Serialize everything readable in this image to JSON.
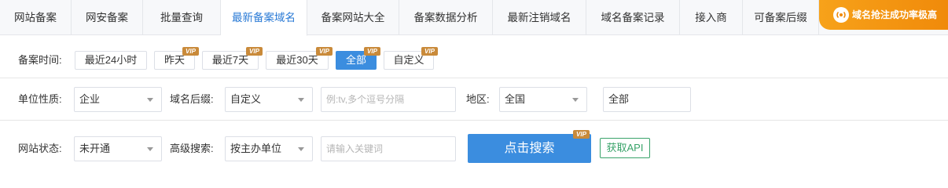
{
  "tabs": [
    {
      "label": "网站备案"
    },
    {
      "label": "网安备案"
    },
    {
      "label": "批量查询"
    },
    {
      "label": "最新备案域名"
    },
    {
      "label": "备案网站大全"
    },
    {
      "label": "备案数据分析"
    },
    {
      "label": "最新注销域名"
    },
    {
      "label": "域名备案记录"
    },
    {
      "label": "接入商"
    },
    {
      "label": "可备案后缀"
    }
  ],
  "active_tab": "最新备案域名",
  "promo": {
    "label": "域名抢注成功率极高"
  },
  "time_filter": {
    "label": "备案时间:",
    "options": [
      {
        "label": "最近24小时",
        "vip": ""
      },
      {
        "label": "昨天",
        "vip": "VIP"
      },
      {
        "label": "最近7天",
        "vip": "VIP"
      },
      {
        "label": "最近30天",
        "vip": "VIP"
      },
      {
        "label": "全部",
        "vip": "VIP"
      },
      {
        "label": "自定义",
        "vip": "VIP"
      }
    ],
    "selected": "全部"
  },
  "filters": {
    "unit_type": {
      "label": "单位性质:",
      "value": "企业"
    },
    "suffix": {
      "label": "域名后缀:",
      "value": "自定义"
    },
    "suffix_input": {
      "placeholder": "例:tv,多个逗号分隔"
    },
    "region": {
      "label": "地区:",
      "value": "全国"
    },
    "sub_region": {
      "value": "全部"
    },
    "site_status": {
      "label": "网站状态:",
      "value": "未开通"
    },
    "advanced": {
      "label": "高级搜索:",
      "value": "按主办单位"
    },
    "keyword_input": {
      "placeholder": "请输入关键词"
    }
  },
  "actions": {
    "search_label": "点击搜索",
    "search_vip": "VIP",
    "api_label": "获取API"
  },
  "colors": {
    "accent": "#3b8ddf",
    "vip": "#c98a3a",
    "promo": "#f7a21a",
    "api": "#39a36a"
  }
}
